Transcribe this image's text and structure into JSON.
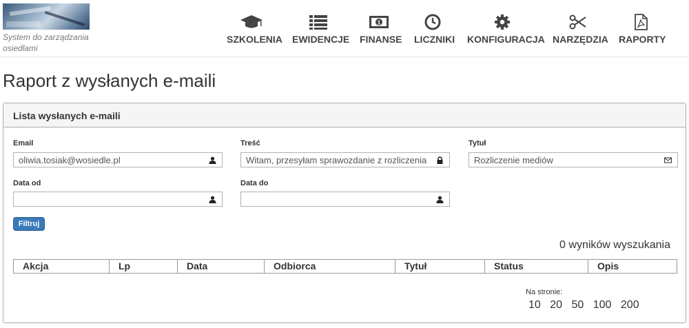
{
  "header": {
    "tagline": "System do zarządzania osiedlami",
    "nav": [
      {
        "label": "SZKOLENIA",
        "icon": "graduation-cap-icon"
      },
      {
        "label": "EWIDENCJE",
        "icon": "list-icon"
      },
      {
        "label": "FINANSE",
        "icon": "money-icon"
      },
      {
        "label": "LICZNIKI",
        "icon": "clock-icon"
      },
      {
        "label": "KONFIGURACJA",
        "icon": "gear-icon"
      },
      {
        "label": "NARZĘDZIA",
        "icon": "scissors-icon"
      },
      {
        "label": "RAPORTY",
        "icon": "pdf-file-icon"
      }
    ]
  },
  "page": {
    "title": "Raport z wysłanych e-maili"
  },
  "panel": {
    "heading": "Lista wysłanych e-maili",
    "filters": {
      "email": {
        "label": "Email",
        "value": "oliwia.tosiak@wosiedle.pl",
        "icon": "user-icon"
      },
      "content": {
        "label": "Treść",
        "value": "Witam, przesyłam sprawozdanie z rozliczenia",
        "icon": "lock-icon"
      },
      "title": {
        "label": "Tytuł",
        "value": "Rozliczenie mediów",
        "icon": "envelope-icon"
      },
      "date_from": {
        "label": "Data od",
        "value": "",
        "icon": "user-icon"
      },
      "date_to": {
        "label": "Data do",
        "value": "",
        "icon": "user-icon"
      }
    },
    "filter_button": "Filtruj",
    "results_text": "0 wyników wyszukania",
    "table": {
      "columns": [
        "Akcja",
        "Lp",
        "Data",
        "Odbiorca",
        "Tytuł",
        "Status",
        "Opis"
      ]
    },
    "pagination": {
      "label": "Na stronie:",
      "options": [
        "10",
        "20",
        "50",
        "100",
        "200"
      ]
    }
  },
  "colors": {
    "accent": "#3a7ab8",
    "panel_border": "#b3aaa0",
    "icon": "#444444"
  }
}
